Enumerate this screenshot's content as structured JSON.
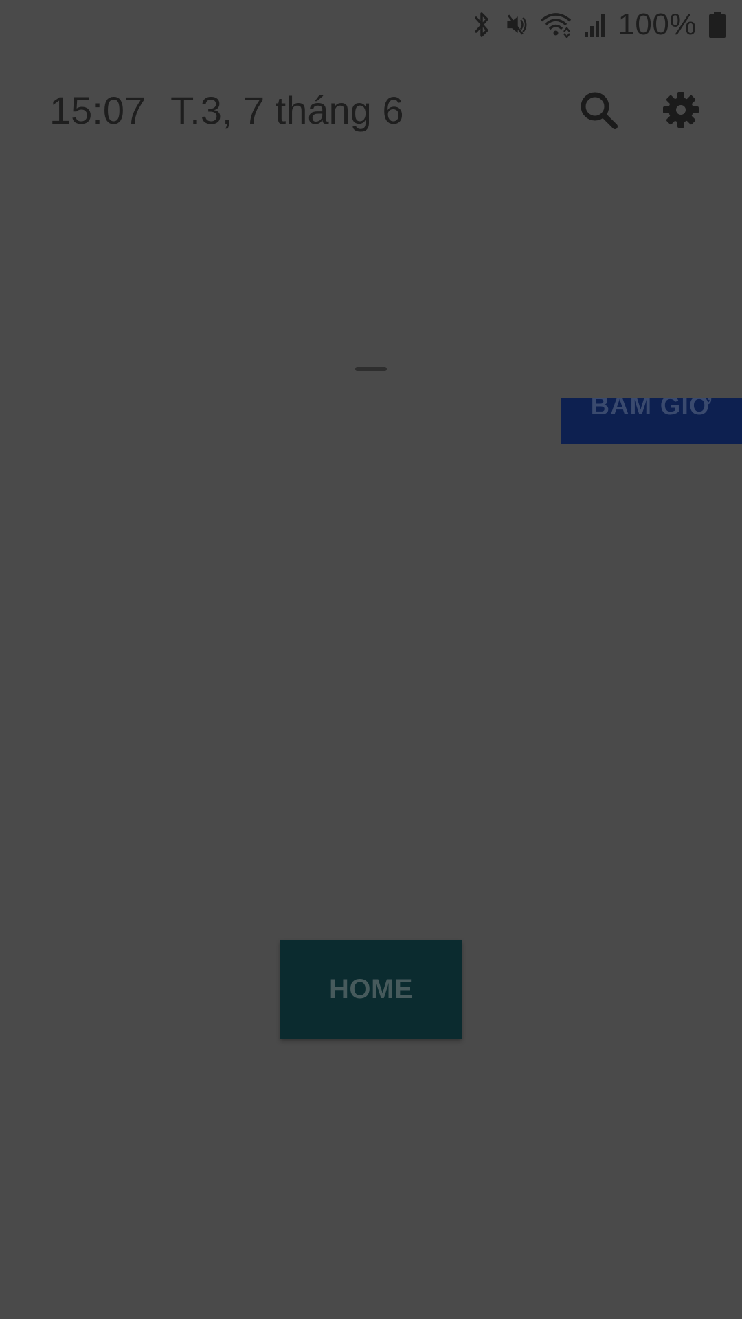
{
  "status_bar": {
    "battery_text": "100%",
    "icons": [
      "bluetooth-icon",
      "mute-icon",
      "wifi-icon",
      "signal-icon",
      "battery-icon"
    ]
  },
  "header": {
    "time": "15:07",
    "date": "T.3, 7 tháng 6",
    "actions": [
      "search-icon",
      "settings-icon"
    ]
  },
  "buttons": {
    "partial_label": "BẤM GIỜ",
    "home_label": "HOME"
  },
  "colors": {
    "scrim": "#4a4a4a",
    "blue_button": "#0d2050",
    "home_button": "#0b2b2f"
  }
}
